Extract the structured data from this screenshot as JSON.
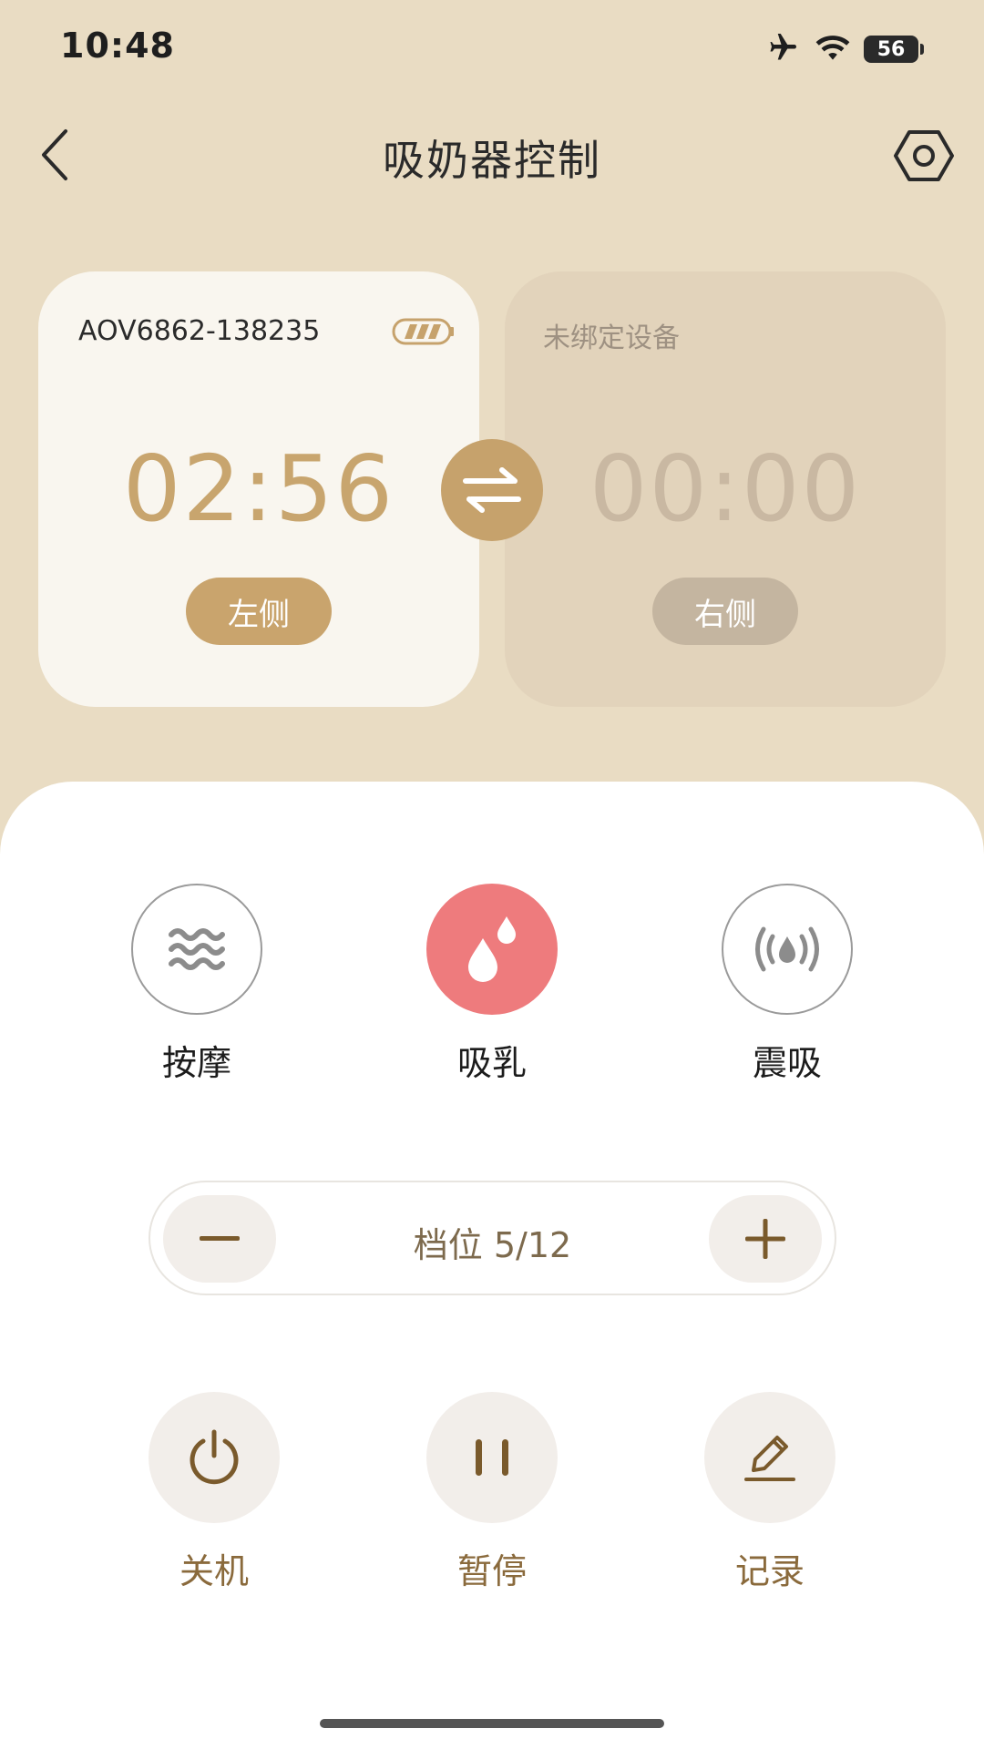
{
  "status_bar": {
    "time": "10:48",
    "battery": "56"
  },
  "header": {
    "title": "吸奶器控制"
  },
  "devices": {
    "left": {
      "name": "AOV6862-138235",
      "timer": "02:56",
      "side_label": "左侧"
    },
    "right": {
      "name": "未绑定设备",
      "timer": "00:00",
      "side_label": "右侧"
    }
  },
  "modes": [
    {
      "label": "按摩",
      "icon": "waves-icon",
      "active": false
    },
    {
      "label": "吸乳",
      "icon": "drops-icon",
      "active": true
    },
    {
      "label": "震吸",
      "icon": "vibrate-drop-icon",
      "active": false
    }
  ],
  "level": {
    "text": "档位 5/12",
    "current": 5,
    "max": 12
  },
  "actions": [
    {
      "label": "关机",
      "icon": "power-icon"
    },
    {
      "label": "暂停",
      "icon": "pause-icon"
    },
    {
      "label": "记录",
      "icon": "pen-icon"
    }
  ],
  "colors": {
    "background": "#e9dcc3",
    "accent": "#c9a46d",
    "active_mode": "#ee7b7d",
    "action_label": "#8a6a3c"
  }
}
